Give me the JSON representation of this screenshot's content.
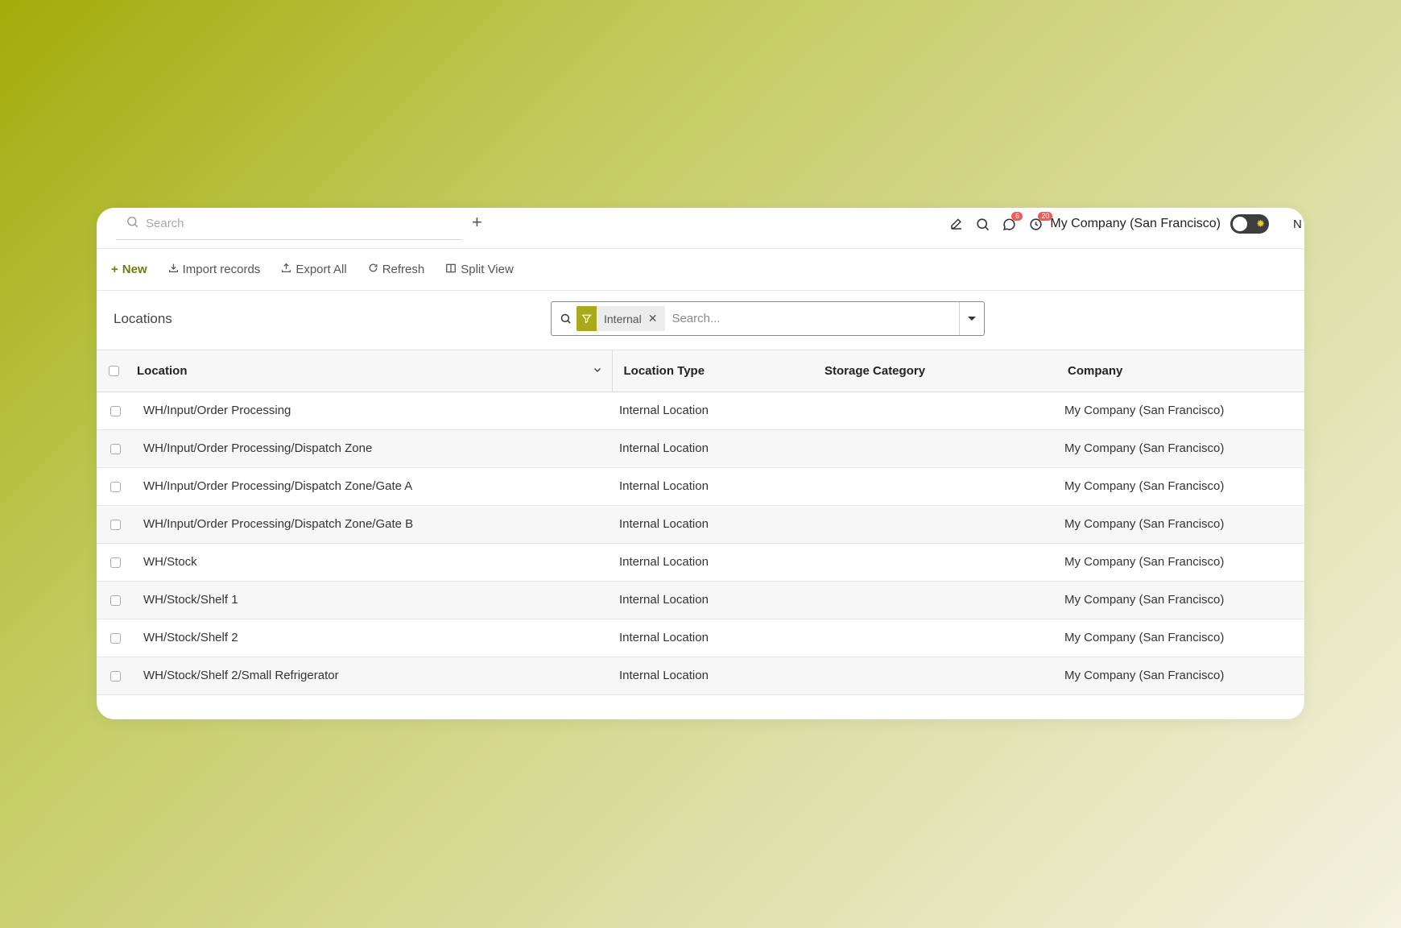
{
  "topbar": {
    "search_placeholder": "Search",
    "add_label": "+",
    "chat_badge": "6",
    "activity_badge": "20",
    "company": "My Company (San Francisco)",
    "user_initial": "N"
  },
  "actions": {
    "new": "New",
    "import": "Import records",
    "export": "Export All",
    "refresh": "Refresh",
    "split": "Split View"
  },
  "page": {
    "title": "Locations",
    "facet_label": "Internal",
    "facet_remove": "✕",
    "search_placeholder": "Search..."
  },
  "table": {
    "columns": [
      "Location",
      "Location Type",
      "Storage Category",
      "Company"
    ],
    "rows": [
      {
        "location": "WH/Input/Order Processing",
        "type": "Internal Location",
        "storage": "",
        "company": "My Company (San Francisco)"
      },
      {
        "location": "WH/Input/Order Processing/Dispatch Zone",
        "type": "Internal Location",
        "storage": "",
        "company": "My Company (San Francisco)"
      },
      {
        "location": "WH/Input/Order Processing/Dispatch Zone/Gate A",
        "type": "Internal Location",
        "storage": "",
        "company": "My Company (San Francisco)"
      },
      {
        "location": "WH/Input/Order Processing/Dispatch Zone/Gate B",
        "type": "Internal Location",
        "storage": "",
        "company": "My Company (San Francisco)"
      },
      {
        "location": "WH/Stock",
        "type": "Internal Location",
        "storage": "",
        "company": "My Company (San Francisco)"
      },
      {
        "location": "WH/Stock/Shelf 1",
        "type": "Internal Location",
        "storage": "",
        "company": "My Company (San Francisco)"
      },
      {
        "location": "WH/Stock/Shelf 2",
        "type": "Internal Location",
        "storage": "",
        "company": "My Company (San Francisco)"
      },
      {
        "location": "WH/Stock/Shelf 2/Small Refrigerator",
        "type": "Internal Location",
        "storage": "",
        "company": "My Company (San Francisco)"
      }
    ]
  },
  "colors": {
    "accent": "#a8aa1c",
    "primary_text": "#6f7a14",
    "badge": "#f05a5a"
  }
}
